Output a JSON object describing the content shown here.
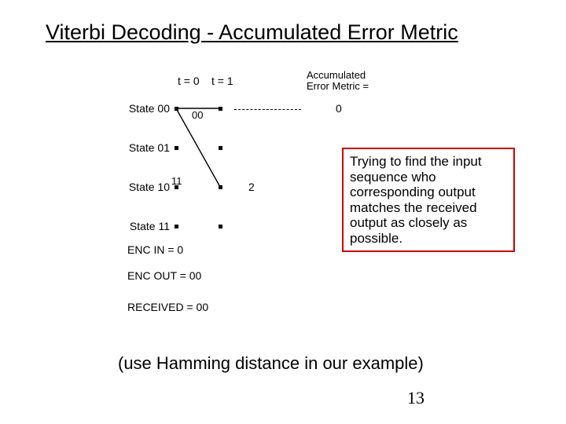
{
  "title": "Viterbi Decoding - Accumulated Error Metric",
  "page_number": "13",
  "subtitle": "(use Hamming distance in our example)",
  "callout_text": "Trying to find the input sequence who corresponding output matches the received output as closely as possible.",
  "diagram": {
    "time_labels": [
      "t = 0",
      "t = 1"
    ],
    "aem_header_line1": "Accumulated",
    "aem_header_line2": "Error Metric =",
    "states": [
      "State 00",
      "State 01",
      "State 10",
      "State 11"
    ],
    "branch_00": "00",
    "branch_11": "11",
    "metric_0": "0",
    "metric_2": "2",
    "enc_in_label": "ENC IN =",
    "enc_in_value": "0",
    "enc_out_label": "ENC OUT =",
    "enc_out_value": "00",
    "received_label": "RECEIVED =",
    "received_value": "00"
  },
  "chart_data": {
    "type": "trellis-diagram",
    "title": "Viterbi Decoding - Accumulated Error Metric",
    "states": [
      "00",
      "01",
      "10",
      "11"
    ],
    "time_steps": [
      "t=0",
      "t=1"
    ],
    "branches": [
      {
        "from_state": "00",
        "to_state": "00",
        "output_bits": "00"
      },
      {
        "from_state": "00",
        "to_state": "10",
        "output_bits": "11"
      }
    ],
    "accumulated_error_metric_at_t1": {
      "state_00": 0,
      "state_10": 2
    },
    "encoder_input": [
      0
    ],
    "encoder_output": [
      "00"
    ],
    "received": [
      "00"
    ],
    "distance_metric": "Hamming"
  }
}
